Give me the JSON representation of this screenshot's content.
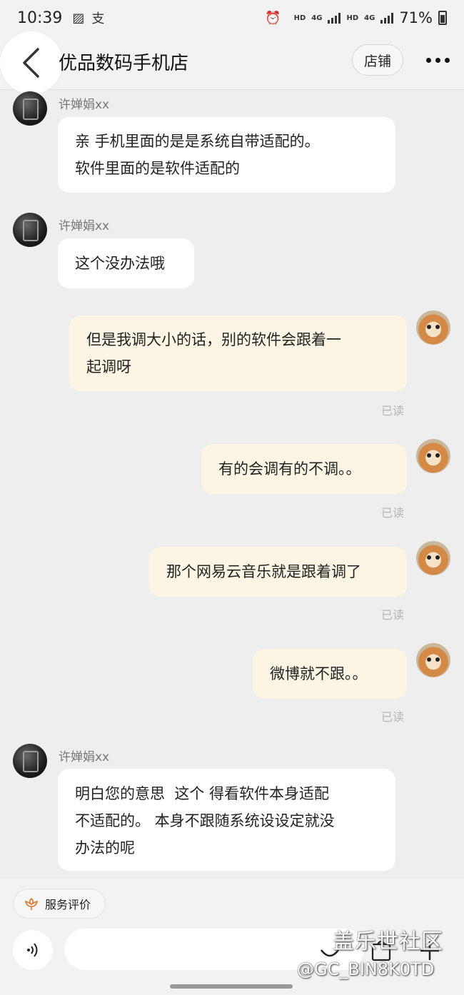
{
  "status_bar": {
    "time": "10:39",
    "left_icons": [
      "gallery-icon",
      "alipay-icon"
    ],
    "network_1": "HD",
    "network_2": "4G",
    "battery": "71%"
  },
  "header": {
    "title": "优品数码手机店",
    "shop_button": "店铺"
  },
  "messages": [
    {
      "side": "in",
      "sender": "许婵娟xx",
      "lines": [
        "亲 手机里面的是是系统自带适配的。",
        "软件里面的是软件适配的"
      ]
    },
    {
      "side": "in",
      "sender": "许婵娟xx",
      "lines": [
        "这个没办法哦"
      ]
    },
    {
      "side": "out",
      "lines": [
        "但是我调大小的话，别的软件会跟着一",
        "起调呀"
      ],
      "status": "已读"
    },
    {
      "side": "out",
      "lines": [
        "有的会调有的不调。。"
      ],
      "status": "已读"
    },
    {
      "side": "out",
      "lines": [
        "那个网易云音乐就是跟着调了"
      ],
      "status": "已读"
    },
    {
      "side": "out",
      "lines": [
        "微博就不跟。。"
      ],
      "status": "已读"
    },
    {
      "side": "in",
      "sender": "许婵娟xx",
      "lines": [
        "明白您的意思  这个 得看软件本身适配",
        "不适配的。 本身不跟随系统设设定就没",
        "办法的呢"
      ]
    }
  ],
  "bottom": {
    "service_chip": "服务评价",
    "input_placeholder": ""
  },
  "watermark": {
    "line1": "盖乐世社区",
    "line2": "@GC_BIN8K0TD"
  },
  "colors": {
    "incoming_bubble": "#ffffff",
    "outgoing_bubble": "#fdf5e4",
    "background": "#eeeeee",
    "read_status": "#b5b5b5"
  }
}
